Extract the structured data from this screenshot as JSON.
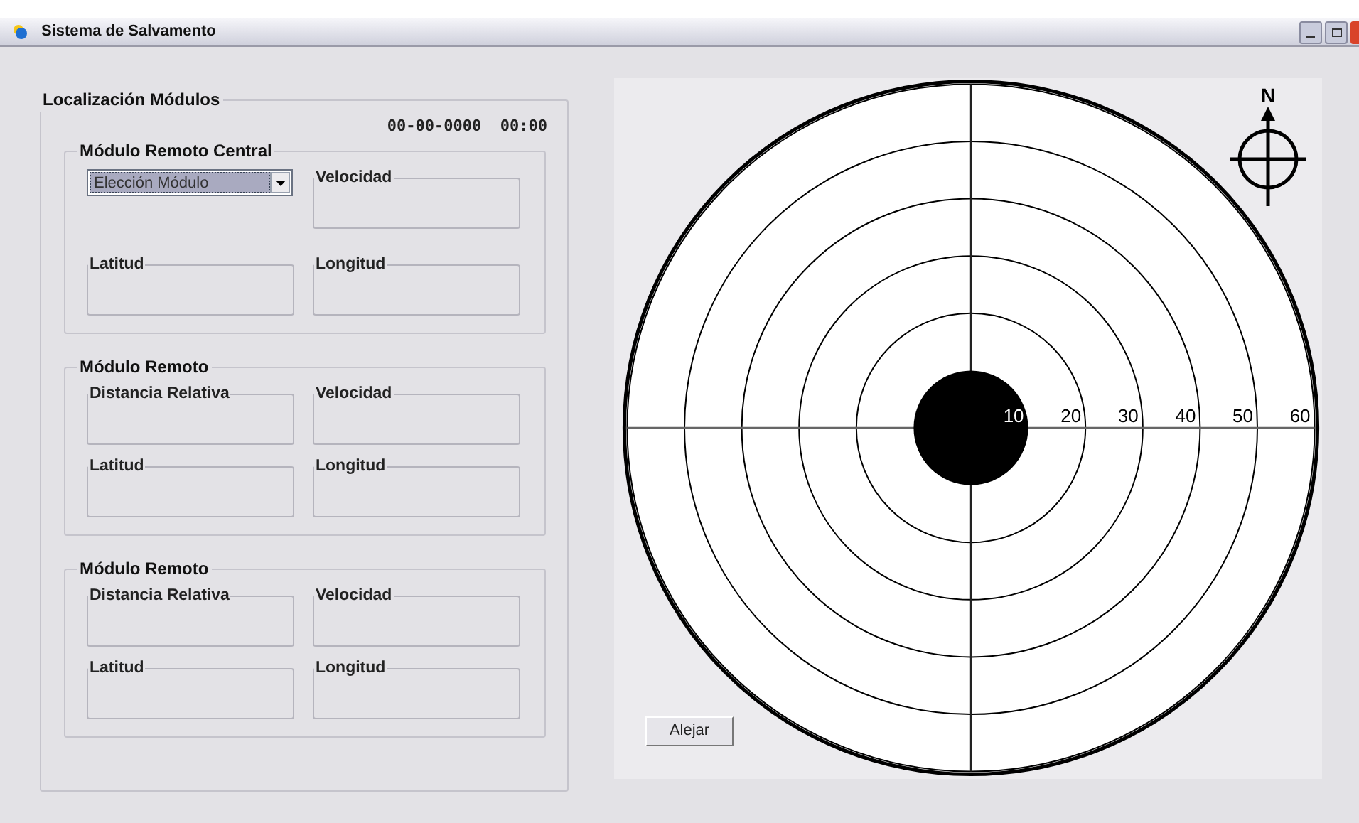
{
  "window": {
    "title": "Sistema de Salvamento"
  },
  "location_panel": {
    "title": "Localización Módulos",
    "datetime": "00-00-0000  00:00",
    "groups": [
      {
        "title": "Módulo Remoto Central",
        "fields": [
          {
            "kind": "dropdown",
            "value": "Elección Módulo"
          },
          {
            "kind": "box",
            "label": "Velocidad"
          },
          {
            "kind": "box",
            "label": "Latitud"
          },
          {
            "kind": "box",
            "label": "Longitud"
          }
        ]
      },
      {
        "title": "Módulo Remoto",
        "fields": [
          {
            "kind": "box",
            "label": "Distancia Relativa"
          },
          {
            "kind": "box",
            "label": "Velocidad"
          },
          {
            "kind": "box",
            "label": "Latitud"
          },
          {
            "kind": "box",
            "label": "Longitud"
          }
        ]
      },
      {
        "title": "Módulo Remoto",
        "fields": [
          {
            "kind": "box",
            "label": "Distancia Relativa"
          },
          {
            "kind": "box",
            "label": "Velocidad"
          },
          {
            "kind": "box",
            "label": "Latitud"
          },
          {
            "kind": "box",
            "label": "Longitud"
          }
        ]
      }
    ]
  },
  "radar": {
    "north_label": "N",
    "ring_labels": [
      "10",
      "20",
      "30",
      "40",
      "50",
      "60"
    ],
    "button": "Alejar"
  }
}
